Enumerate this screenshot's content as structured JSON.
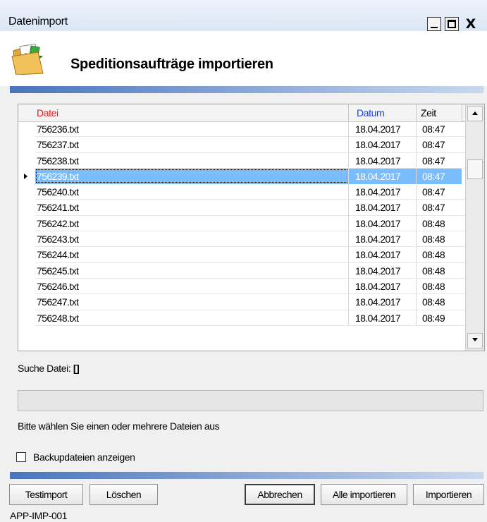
{
  "window": {
    "title": "Datenimport",
    "controls": {
      "minimize": "_",
      "maximize": "□",
      "close": "X"
    }
  },
  "header": {
    "title": "Speditionsaufträge importieren",
    "icon": "folder-import-icon"
  },
  "grid": {
    "columns": [
      "Datei",
      "Datum",
      "Zeit"
    ],
    "column_colors": {
      "Datei": "#e02020",
      "Datum": "#1a3fd1",
      "Zeit": "#000000"
    },
    "rows": [
      {
        "file": "756236.txt",
        "date": "18.04.2017",
        "time": "08:47"
      },
      {
        "file": "756237.txt",
        "date": "18.04.2017",
        "time": "08:47"
      },
      {
        "file": "756238.txt",
        "date": "18.04.2017",
        "time": "08:47"
      },
      {
        "file": "756239.txt",
        "date": "18.04.2017",
        "time": "08:47",
        "selected": true
      },
      {
        "file": "756240.txt",
        "date": "18.04.2017",
        "time": "08:47"
      },
      {
        "file": "756241.txt",
        "date": "18.04.2017",
        "time": "08:47"
      },
      {
        "file": "756242.txt",
        "date": "18.04.2017",
        "time": "08:48"
      },
      {
        "file": "756243.txt",
        "date": "18.04.2017",
        "time": "08:48"
      },
      {
        "file": "756244.txt",
        "date": "18.04.2017",
        "time": "08:48"
      },
      {
        "file": "756245.txt",
        "date": "18.04.2017",
        "time": "08:48"
      },
      {
        "file": "756246.txt",
        "date": "18.04.2017",
        "time": "08:48"
      },
      {
        "file": "756247.txt",
        "date": "18.04.2017",
        "time": "08:48"
      },
      {
        "file": "756248.txt",
        "date": "18.04.2017",
        "time": "08:49"
      }
    ],
    "selection_color": "#3399ff"
  },
  "search": {
    "label": "Suche Datei:",
    "value": "[]"
  },
  "progress": {
    "value": 0
  },
  "hint": "Bitte wählen Sie einen oder mehrere Dateien aus",
  "backup_checkbox": {
    "label": "Backupdateien anzeigen",
    "checked": false
  },
  "buttons": {
    "testimport": "Testimport",
    "loeschen": "Löschen",
    "abbrechen": "Abbrechen",
    "alle_importieren": "Alle importieren",
    "importieren": "Importieren"
  },
  "footer": {
    "code": "APP-IMP-001"
  },
  "accent_color": "#4a75bd"
}
